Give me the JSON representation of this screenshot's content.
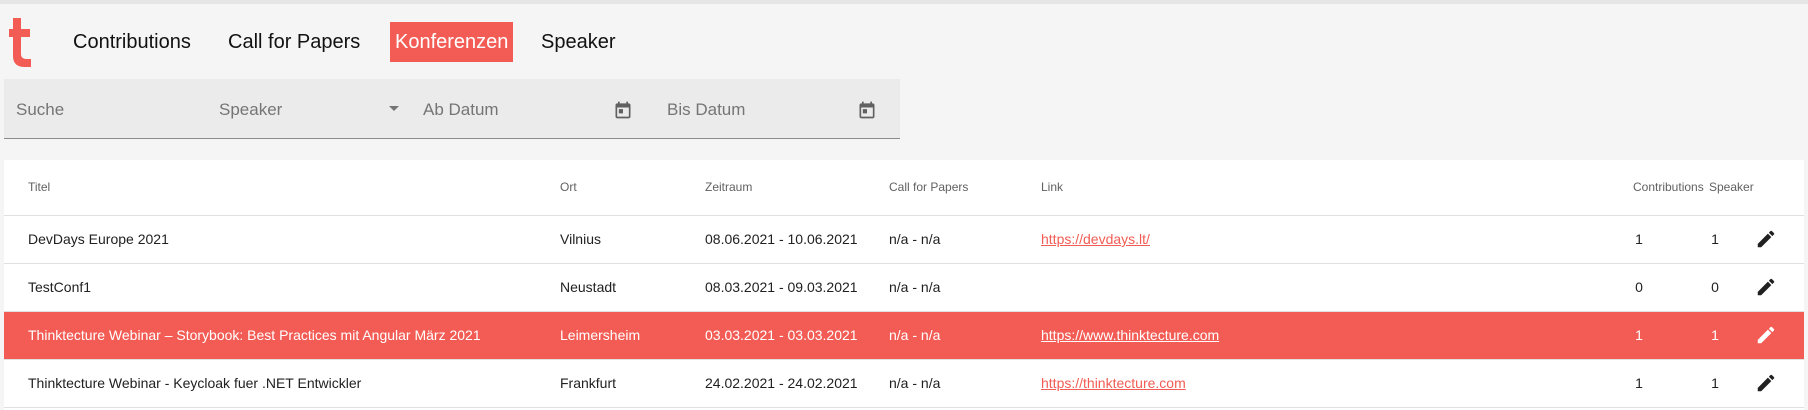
{
  "nav": {
    "items": [
      {
        "label": "Contributions",
        "active": false
      },
      {
        "label": "Call for Papers",
        "active": false
      },
      {
        "label": "Konferenzen",
        "active": true
      },
      {
        "label": "Speaker",
        "active": false
      }
    ]
  },
  "filters": {
    "search": "Suche",
    "speaker": "Speaker",
    "from_date": "Ab Datum",
    "to_date": "Bis Datum"
  },
  "table": {
    "headers": {
      "title": "Titel",
      "location": "Ort",
      "period": "Zeitraum",
      "cfp": "Call for Papers",
      "link": "Link",
      "contributions": "Contributions",
      "speaker": "Speaker"
    },
    "rows": [
      {
        "title": "DevDays Europe 2021",
        "location": "Vilnius",
        "period": "08.06.2021 - 10.06.2021",
        "cfp": "n/a - n/a",
        "link": "https://devdays.lt/",
        "contributions": "1",
        "speaker": "1",
        "selected": false
      },
      {
        "title": "TestConf1",
        "location": "Neustadt",
        "period": "08.03.2021 - 09.03.2021",
        "cfp": "n/a - n/a",
        "link": "",
        "contributions": "0",
        "speaker": "0",
        "selected": false
      },
      {
        "title": "Thinktecture Webinar – Storybook: Best Practices mit Angular März 2021",
        "location": "Leimersheim",
        "period": "03.03.2021 - 03.03.2021",
        "cfp": "n/a - n/a",
        "link": "https://www.thinktecture.com",
        "contributions": "1",
        "speaker": "1",
        "selected": true
      },
      {
        "title": "Thinktecture Webinar - Keycloak fuer .NET Entwickler",
        "location": "Frankfurt",
        "period": "24.02.2021 - 24.02.2021",
        "cfp": "n/a - n/a",
        "link": "https://thinktecture.com",
        "contributions": "1",
        "speaker": "1",
        "selected": false
      }
    ]
  },
  "colors": {
    "accent": "#f25c54",
    "background": "#f5f5f5"
  }
}
